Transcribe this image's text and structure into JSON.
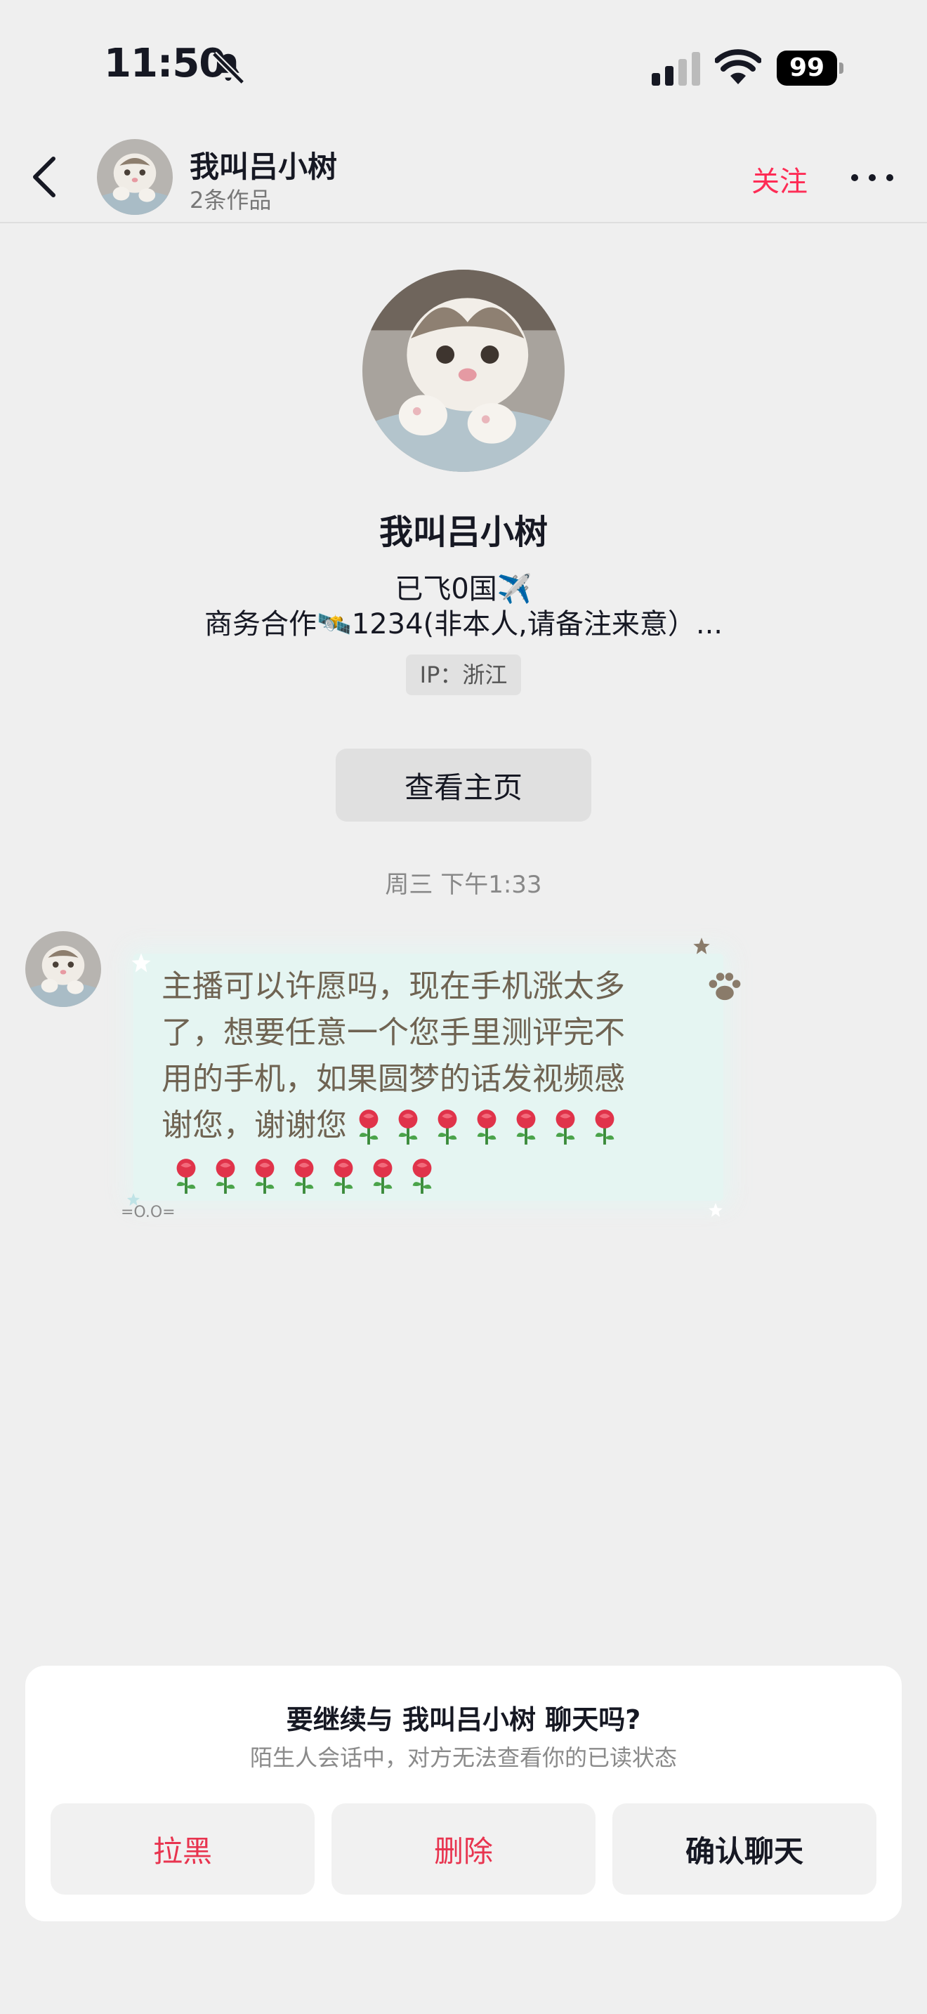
{
  "status_bar": {
    "time": "11:50",
    "battery": "99"
  },
  "nav": {
    "name": "我叫吕小树",
    "subtitle": "2条作品",
    "follow_label": "关注"
  },
  "profile": {
    "name": "我叫吕小树",
    "bio_line1": "已飞0国✈️",
    "bio_line2": "商务合作🛰️1234(非本人,请备注来意）...",
    "ip": "IP：浙江",
    "homepage_button": "查看主页"
  },
  "chat": {
    "timestamp": "周三 下午1:33",
    "message": {
      "line1": "主播可以许愿吗，现在手机涨太多",
      "line2": "了，想要任意一个您手里测评完不",
      "line3": "用的手机，如果圆梦的话发视频感",
      "line4": "谢您，谢谢您",
      "roses_line4": 7,
      "roses_line5": 7,
      "decoration": "=O.O="
    }
  },
  "prompt_card": {
    "title": "要继续与 我叫吕小树 聊天吗?",
    "subtitle": "陌生人会话中，对方无法查看你的已读状态",
    "buttons": {
      "block": "拉黑",
      "delete": "删除",
      "confirm": "确认聊天"
    },
    "colors": {
      "danger": "#e8344f",
      "accent": "#fe2c55"
    }
  }
}
